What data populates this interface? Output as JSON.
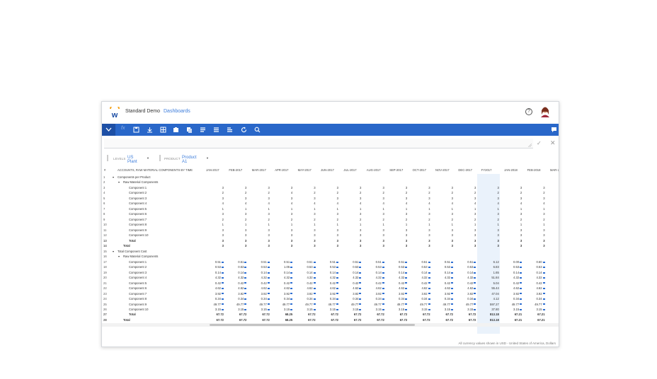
{
  "app": {
    "title": "Standard Demo",
    "breadcrumb": "Dashboards",
    "help": "?"
  },
  "toolbar": {
    "icons": [
      "chevron-down-icon",
      "fx-icon",
      "save-icon",
      "download-icon",
      "grid-icon",
      "clipboard-icon",
      "copy-icon",
      "list-icon",
      "list2-icon",
      "list3-icon",
      "refresh-icon",
      "search-icon",
      "comment-icon"
    ],
    "fx": "fx"
  },
  "formula_bar": {
    "confirm": "✓",
    "cancel": "✕"
  },
  "filters": {
    "levels_label": "LEVELS",
    "levels_value": "US Plant",
    "product_label": "PRODUCT",
    "product_value": "Product A1"
  },
  "grid": {
    "corner": "#",
    "row_header": "ACCOUNTS, RAW MATERIAL COMPONENTS BY TIME",
    "columns": [
      "JAN-2017",
      "FEB-2017",
      "MAR-2017",
      "APR-2017",
      "MAY-2017",
      "JUN-2017",
      "JUL-2017",
      "AUG-2017",
      "SEP-2017",
      "OCT-2017",
      "NOV-2017",
      "DEC-2017",
      "FY2017",
      "JAN-2018",
      "FEB-2018",
      "MAR-2"
    ],
    "rows": [
      {
        "n": "1",
        "label": "Components per Product",
        "indent": 0,
        "toggle": "▾",
        "cells": []
      },
      {
        "n": "2",
        "label": "Raw Material Components",
        "indent": 1,
        "toggle": "▾",
        "cells": []
      },
      {
        "n": "3",
        "label": "Component 1",
        "indent": 2,
        "cells": [
          "3",
          "3",
          "3",
          "3",
          "3",
          "3",
          "3",
          "3",
          "3",
          "3",
          "3",
          "3",
          "3",
          "3",
          "3"
        ]
      },
      {
        "n": "4",
        "label": "Component 2",
        "indent": 2,
        "cells": [
          "2",
          "2",
          "2",
          "4",
          "2",
          "2",
          "2",
          "2",
          "2",
          "2",
          "2",
          "2",
          "2",
          "2",
          "2"
        ]
      },
      {
        "n": "5",
        "label": "Component 3",
        "indent": 2,
        "cells": [
          "3",
          "3",
          "3",
          "3",
          "3",
          "3",
          "3",
          "3",
          "3",
          "3",
          "3",
          "3",
          "3",
          "3",
          "3"
        ]
      },
      {
        "n": "6",
        "label": "Component 4",
        "indent": 2,
        "cells": [
          "4",
          "4",
          "4",
          "4",
          "4",
          "4",
          "4",
          "4",
          "4",
          "4",
          "4",
          "4",
          "4",
          "4",
          "4"
        ]
      },
      {
        "n": "7",
        "label": "Component 5",
        "indent": 2,
        "cells": [
          "1",
          "1",
          "1",
          "1",
          "1",
          "1",
          "1",
          "1",
          "1",
          "1",
          "1",
          "1",
          "1",
          "1",
          "1"
        ]
      },
      {
        "n": "8",
        "label": "Component 6",
        "indent": 2,
        "cells": [
          "3",
          "3",
          "3",
          "3",
          "3",
          "3",
          "3",
          "3",
          "3",
          "3",
          "3",
          "3",
          "3",
          "3",
          "3"
        ]
      },
      {
        "n": "9",
        "label": "Component 7",
        "indent": 2,
        "cells": [
          "2",
          "2",
          "2",
          "2",
          "2",
          "2",
          "2",
          "2",
          "2",
          "2",
          "2",
          "2",
          "2",
          "2",
          "2"
        ]
      },
      {
        "n": "10",
        "label": "Component 8",
        "indent": 2,
        "cells": [
          "1",
          "1",
          "1",
          "1",
          "1",
          "1",
          "1",
          "1",
          "1",
          "1",
          "1",
          "1",
          "1",
          "1",
          "1"
        ]
      },
      {
        "n": "11",
        "label": "Component 9",
        "indent": 2,
        "cells": [
          "3",
          "3",
          "3",
          "3",
          "3",
          "3",
          "3",
          "3",
          "3",
          "3",
          "3",
          "3",
          "3",
          "3",
          "3"
        ]
      },
      {
        "n": "12",
        "label": "Component 10",
        "indent": 2,
        "cells": [
          "3",
          "3",
          "3",
          "3",
          "3",
          "3",
          "3",
          "3",
          "3",
          "3",
          "3",
          "3",
          "3",
          "3",
          "3"
        ]
      },
      {
        "n": "13",
        "label": "Total",
        "indent": 2,
        "bold": true,
        "cells": [
          "3",
          "3",
          "3",
          "3",
          "3",
          "3",
          "3",
          "3",
          "3",
          "3",
          "3",
          "3",
          "3",
          "3",
          "3"
        ]
      },
      {
        "n": "14",
        "label": "Total",
        "indent": 1,
        "bold": true,
        "cells": [
          "3",
          "3",
          "3",
          "3",
          "3",
          "3",
          "3",
          "3",
          "3",
          "3",
          "3",
          "3",
          "3",
          "3",
          "3"
        ]
      },
      {
        "n": "15",
        "label": "Total Component Cost",
        "indent": 0,
        "toggle": "▾",
        "cells": []
      },
      {
        "n": "16",
        "label": "Raw Material Components",
        "indent": 1,
        "toggle": "▾",
        "cells": []
      },
      {
        "n": "17",
        "label": "Component 1",
        "indent": 2,
        "tick": true,
        "cells": [
          "0.51",
          "0.51",
          "0.51",
          "0.51",
          "0.51",
          "0.51",
          "0.51",
          "0.51",
          "0.51",
          "0.51",
          "0.51",
          "0.51",
          "6.12",
          "0.00",
          "0.60"
        ]
      },
      {
        "n": "18",
        "label": "Component 2",
        "indent": 2,
        "tick": true,
        "cells": [
          "0.53",
          "0.53",
          "0.53",
          "1.05",
          "0.53",
          "0.53",
          "0.53",
          "0.53",
          "0.53",
          "0.53",
          "0.53",
          "0.53",
          "6.83",
          "0.53",
          "0.53"
        ]
      },
      {
        "n": "19",
        "label": "Component 3",
        "indent": 2,
        "tick": true,
        "cells": [
          "0.14",
          "0.14",
          "0.14",
          "0.14",
          "0.14",
          "0.14",
          "0.14",
          "0.14",
          "0.14",
          "0.14",
          "0.14",
          "0.14",
          "1.65",
          "0.14",
          "0.14"
        ]
      },
      {
        "n": "20",
        "label": "Component 4",
        "indent": 2,
        "tick": true,
        "cells": [
          "4.32",
          "4.32",
          "4.32",
          "4.32",
          "4.32",
          "4.32",
          "4.32",
          "4.32",
          "4.32",
          "4.32",
          "4.32",
          "4.32",
          "51.84",
          "4.32",
          "4.32"
        ]
      },
      {
        "n": "21",
        "label": "Component 5",
        "indent": 2,
        "tick": true,
        "cells": [
          "0.42",
          "0.42",
          "0.42",
          "0.42",
          "0.42",
          "0.42",
          "0.42",
          "0.42",
          "0.42",
          "0.42",
          "0.42",
          "0.42",
          "5.04",
          "0.42",
          "0.42"
        ]
      },
      {
        "n": "22",
        "label": "Component 6",
        "indent": 2,
        "tick": true,
        "cells": [
          "4.62",
          "4.62",
          "4.62",
          "4.62",
          "4.62",
          "4.62",
          "4.62",
          "4.62",
          "4.62",
          "4.62",
          "4.62",
          "4.62",
          "55.44",
          "4.62",
          "4.62"
        ]
      },
      {
        "n": "23",
        "label": "Component 7",
        "indent": 2,
        "tick": true,
        "cells": [
          "3.92",
          "3.92",
          "3.92",
          "3.92",
          "3.92",
          "3.92",
          "3.92",
          "3.92",
          "3.92",
          "3.92",
          "3.92",
          "3.92",
          "47.04",
          "3.92",
          "3.92"
        ]
      },
      {
        "n": "24",
        "label": "Component 8",
        "indent": 2,
        "tick": true,
        "cells": [
          "0.34",
          "0.34",
          "0.34",
          "0.34",
          "0.34",
          "0.34",
          "0.34",
          "0.34",
          "0.34",
          "0.34",
          "0.34",
          "0.34",
          "4.12",
          "0.34",
          "0.34"
        ]
      },
      {
        "n": "25",
        "label": "Component 9",
        "indent": 2,
        "tick": true,
        "cells": [
          "49.77",
          "49.77",
          "49.77",
          "49.77",
          "49.77",
          "49.77",
          "49.77",
          "49.77",
          "49.77",
          "49.77",
          "49.77",
          "49.77",
          "597.27",
          "49.77",
          "49.77"
        ]
      },
      {
        "n": "26",
        "label": "Component 10",
        "indent": 2,
        "tick": true,
        "cells": [
          "3.15",
          "3.15",
          "3.15",
          "3.15",
          "3.15",
          "3.15",
          "3.15",
          "3.15",
          "3.15",
          "3.15",
          "3.15",
          "3.15",
          "37.80",
          "3.15",
          "3.15"
        ]
      },
      {
        "n": "27",
        "label": "Total",
        "indent": 2,
        "bold": true,
        "cells": [
          "67.72",
          "67.72",
          "67.72",
          "68.25",
          "67.72",
          "67.72",
          "67.72",
          "67.72",
          "67.72",
          "67.72",
          "67.72",
          "67.72",
          "813.18",
          "67.21",
          "67.21"
        ]
      },
      {
        "n": "28",
        "label": "Total",
        "indent": 1,
        "bold": true,
        "cells": [
          "67.72",
          "67.72",
          "67.72",
          "68.25",
          "67.72",
          "67.72",
          "67.72",
          "67.72",
          "67.72",
          "67.72",
          "67.72",
          "67.72",
          "813.18",
          "67.21",
          "67.21"
        ]
      }
    ]
  },
  "footer": "All currency values shown in USD - United States of America, Dollars",
  "colors": {
    "toolbar": "#2967c9",
    "toolbar_dark": "#1d4fa5",
    "link": "#3d7ddb",
    "highlight": "#eaf2fb"
  }
}
